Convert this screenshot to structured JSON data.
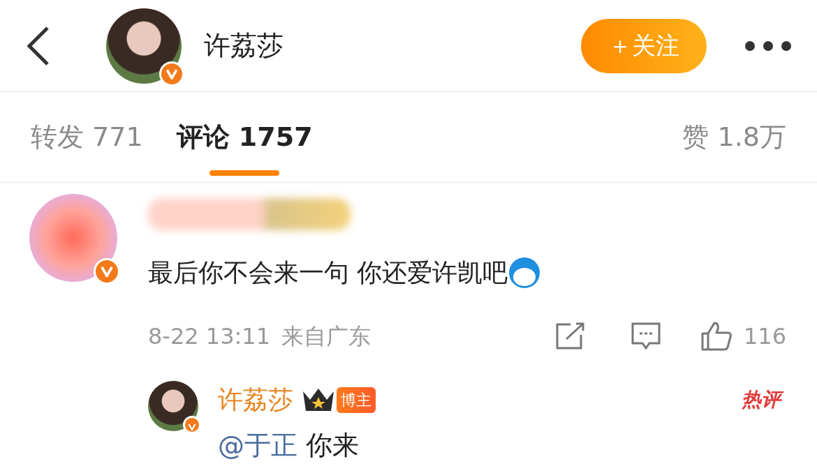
{
  "header": {
    "name": "许荔莎",
    "verified": true,
    "follow_button": "＋关注"
  },
  "tabs": [
    {
      "label": "转发",
      "count": "771",
      "selected": false
    },
    {
      "label": "评论",
      "count": "1757",
      "selected": true
    },
    {
      "label": "赞",
      "count": "1.8万",
      "selected": false
    }
  ],
  "comment": {
    "verified": true,
    "text": "最后你不会来一句 你还爱许凯吧",
    "time": "8-22 13:11",
    "location": "来自广东",
    "likes": "116",
    "reply": {
      "author": "许荔莎",
      "verified": true,
      "badge": "博主",
      "tag": "热评",
      "mention": "@于正",
      "text": "你来"
    }
  }
}
